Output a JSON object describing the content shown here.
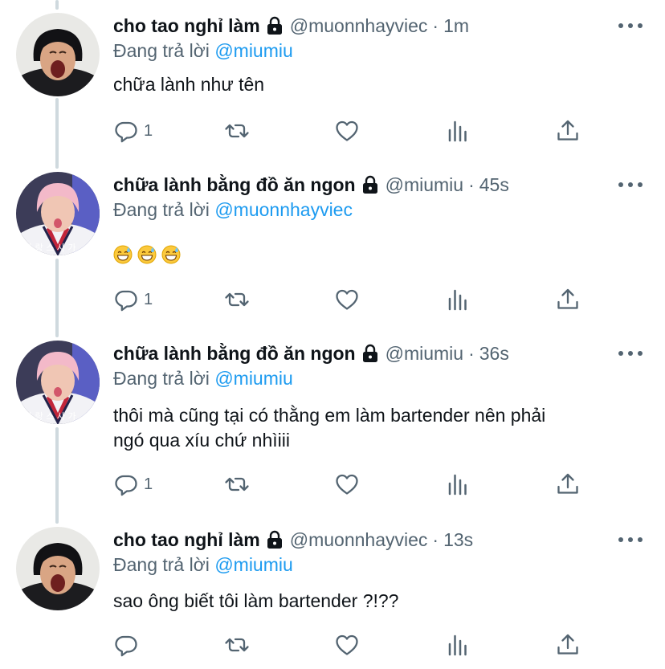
{
  "tweets": [
    {
      "author": "cho tao nghỉ làm",
      "handle": "@muonnhayviec",
      "dot": "·",
      "time": "1m",
      "reply_prefix": "Đang trả lời",
      "reply_to": "@miumiu",
      "text": "chữa lành như tên",
      "reply_count": "1",
      "avatar": "boy-yelling-avatar"
    },
    {
      "author": "chữa lành bằng đồ ăn ngon",
      "handle": "@miumiu",
      "dot": "·",
      "time": "45s",
      "reply_prefix": "Đang trả lời",
      "reply_to": "@muonnhayviec",
      "emojis": [
        "grinning-sweat-emoji",
        "grinning-sweat-emoji",
        "grinning-sweat-emoji"
      ],
      "reply_count": "1",
      "avatar": "pink-hair-avatar"
    },
    {
      "author": "chữa lành bằng đồ ăn ngon",
      "handle": "@miumiu",
      "dot": "·",
      "time": "36s",
      "reply_prefix": "Đang trả lời",
      "reply_to": "@miumiu",
      "text_line1": "thôi mà cũng tại có thằng em làm bartender nên phải",
      "text_line2": "ngó qua xíu chứ nhìiii",
      "reply_count": "1",
      "avatar": "pink-hair-avatar"
    },
    {
      "author": "cho tao nghỉ làm",
      "handle": "@muonnhayviec",
      "dot": "·",
      "time": "13s",
      "reply_prefix": "Đang trả lời",
      "reply_to": "@miumiu",
      "text": "sao ông biết tôi làm bartender ?!??",
      "reply_count": "",
      "avatar": "boy-yelling-avatar"
    }
  ],
  "icons": {
    "reply": "reply-icon",
    "retweet": "retweet-icon",
    "like": "like-icon",
    "stats": "stats-icon",
    "share": "share-icon",
    "lock": "lock-icon",
    "more": "more-icon"
  },
  "colors": {
    "text": "#0f1419",
    "muted": "#536471",
    "link": "#1d9bf0",
    "thread_line": "#cfd9de"
  }
}
